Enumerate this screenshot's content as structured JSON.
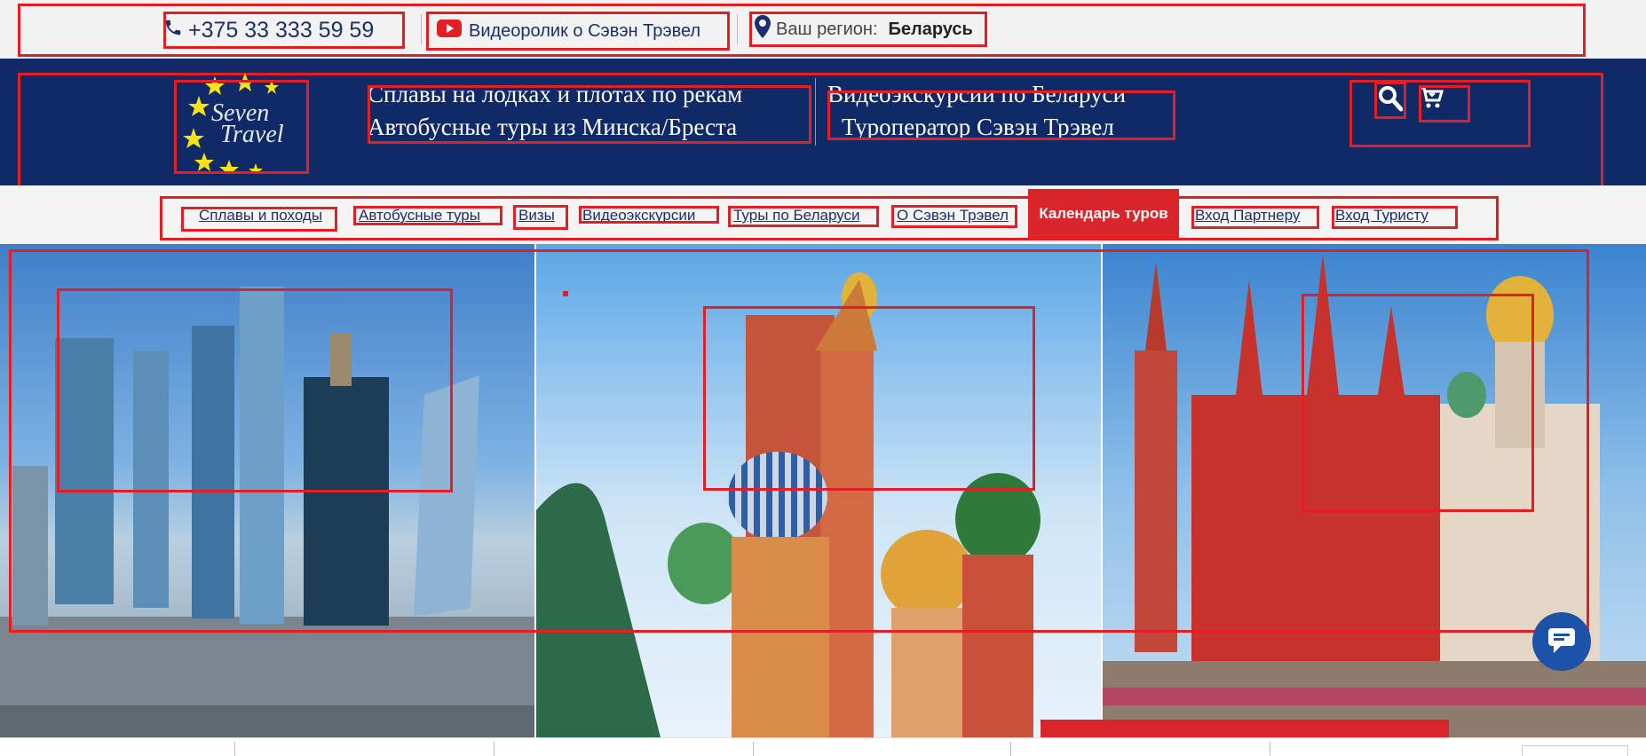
{
  "topbar": {
    "phone": "+375 33 333 59 59",
    "phone_icon": "phone-icon",
    "video_label": "Видеоролик о Сэвэн Трэвел",
    "video_icon": "youtube-icon",
    "region_label": "Ваш регион:",
    "region_value": "Беларусь",
    "region_icon": "map-pin-icon"
  },
  "header": {
    "logo_text_line1": "Seven",
    "logo_text_line2": "Travel",
    "links_left": [
      "Сплавы на лодках и плотах по рекам",
      "Автобусные туры из Минска/Бреста"
    ],
    "links_right": [
      "Видеоэкскурсии по Беларуси",
      "Туроператор Сэвэн Трэвел"
    ],
    "search_icon": "search-icon",
    "cart_icon": "cart-icon"
  },
  "nav": {
    "items": [
      {
        "label": "Сплавы и походы"
      },
      {
        "label": "Автобусные туры"
      },
      {
        "label": "Визы"
      },
      {
        "label": "Видеоэкскурсии"
      },
      {
        "label": "Туры по Беларуси"
      },
      {
        "label": "О Сэвэн Трэвел"
      },
      {
        "label": "Календарь туров",
        "highlight": true
      },
      {
        "label": "Вход Партнеру"
      },
      {
        "label": "Вход Туристу"
      }
    ]
  },
  "hero": {
    "panels": [
      "moscow-city-skyscrapers",
      "st-basils-cathedral",
      "red-square-historical-museum"
    ]
  },
  "chat": {
    "icon": "chat-icon"
  },
  "colors": {
    "header_bg": "#0f2a66",
    "accent_red": "#e31e24",
    "nav_text": "#1b2f6b",
    "highlight_bg": "#d9252c"
  }
}
